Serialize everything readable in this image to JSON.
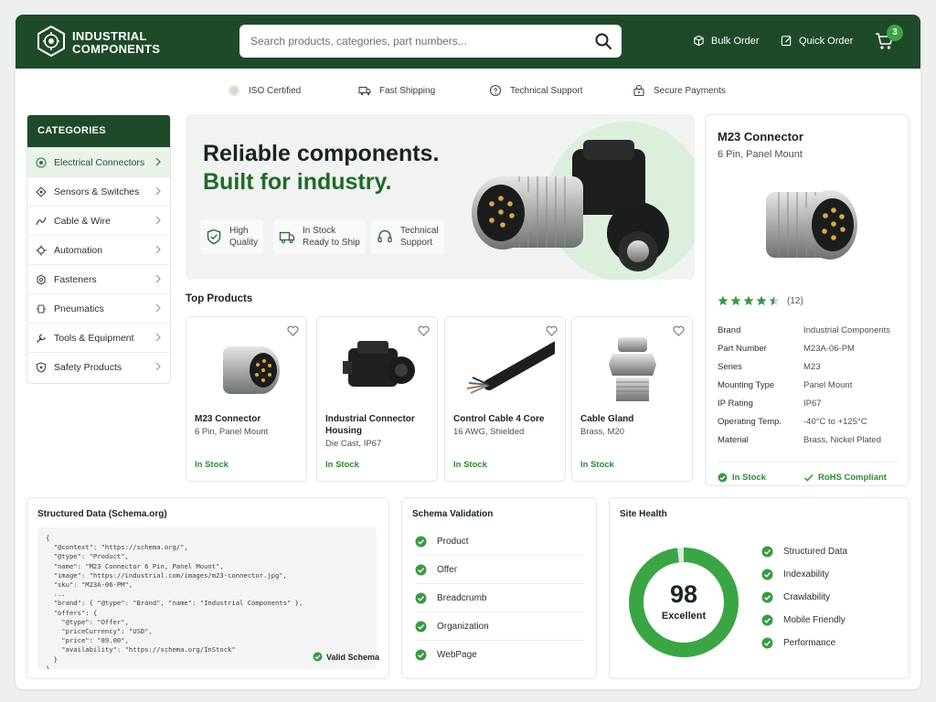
{
  "header": {
    "brand_line1": "INDUSTRIAL",
    "brand_line2": "COMPONENTS",
    "search_placeholder": "Search products, categories, part numbers...",
    "bulk_order": "Bulk Order",
    "quick_order": "Quick Order",
    "cart_count": "3"
  },
  "trust_bar": [
    {
      "label": "ISO Certified",
      "icon": "iso-badge-icon"
    },
    {
      "label": "Fast Shipping",
      "icon": "truck-icon"
    },
    {
      "label": "Technical Support",
      "icon": "support-icon"
    },
    {
      "label": "Secure Payments",
      "icon": "lock-icon"
    }
  ],
  "categories": {
    "title": "CATEGORIES",
    "items": [
      {
        "label": "Electrical Connectors",
        "icon": "connector-icon"
      },
      {
        "label": "Sensors & Switches",
        "icon": "sensor-icon"
      },
      {
        "label": "Cable & Wire",
        "icon": "cable-icon"
      },
      {
        "label": "Automation",
        "icon": "gear-icon"
      },
      {
        "label": "Fasteners",
        "icon": "fastener-icon"
      },
      {
        "label": "Pneumatics",
        "icon": "pneumatics-icon"
      },
      {
        "label": "Tools & Equipment",
        "icon": "wrench-icon"
      },
      {
        "label": "Safety Products",
        "icon": "shield-icon"
      }
    ]
  },
  "hero": {
    "headline_1": "Reliable components.",
    "headline_2": "Built for industry.",
    "features": [
      {
        "line1": "High",
        "line2": "Quality",
        "icon": "shield-check-icon"
      },
      {
        "line1": "In Stock",
        "line2": "Ready to Ship",
        "icon": "truck-icon"
      },
      {
        "line1": "Technical",
        "line2": "Support",
        "icon": "headset-icon"
      }
    ]
  },
  "top_products": {
    "title": "Top Products",
    "items": [
      {
        "name": "M23 Connector",
        "desc": "6 Pin, Panel Mount",
        "stock": "In Stock"
      },
      {
        "name": "Industrial Connector Housing",
        "desc": "Die Cast, IP67",
        "stock": "In Stock"
      },
      {
        "name": "Control Cable 4 Core",
        "desc": "16 AWG, Shielded",
        "stock": "In Stock"
      },
      {
        "name": "Cable Gland",
        "desc": "Brass, M20",
        "stock": "In Stock"
      }
    ]
  },
  "detail": {
    "title": "M23 Connector",
    "subtitle": "6 Pin, Panel Mount",
    "rating": 4.5,
    "reviews": "(12)",
    "specs": [
      {
        "k": "Brand",
        "v": "Industrial Components"
      },
      {
        "k": "Part Number",
        "v": "M23A-06-PM"
      },
      {
        "k": "Series",
        "v": "M23"
      },
      {
        "k": "Mounting Type",
        "v": "Panel Mount"
      },
      {
        "k": "IP Rating",
        "v": "IP67"
      },
      {
        "k": "Operating Temp.",
        "v": "-40°C to +125°C"
      },
      {
        "k": "Material",
        "v": "Brass, Nickel Plated"
      }
    ],
    "in_stock": "In Stock",
    "rohs": "RoHS Compliant"
  },
  "schema_panel": {
    "title": "Structured Data (Schema.org)",
    "code": "{\n  \"@context\": \"https://schema.org/\",\n  \"@type\": \"Product\",\n  \"name\": \"M23 Connector 6 Pin, Panel Mount\",\n  \"image\": \"https://industrial.com/images/m23-connector.jpg\",\n  \"sku\": \"M23A-06-PM\",\n  ...\n  \"brand\": { \"@type\": \"Brand\", \"name\": \"Industrial Components\" },\n  \"offers\": {\n    \"@type\": \"Offer\",\n    \"priceCurrency\": \"USD\",\n    \"price\": \"89.00\",\n    \"availability\": \"https://schema.org/InStock\"\n  }\n}",
    "valid": "Valid Schema"
  },
  "validation": {
    "title": "Schema Validation",
    "items": [
      "Product",
      "Offer",
      "Breadcrumb",
      "Organization",
      "WebPage"
    ]
  },
  "health": {
    "title": "Site Health",
    "score": "98",
    "score_value": 98,
    "score_label": "Excellent",
    "items": [
      "Structured Data",
      "Indexability",
      "Crawlability",
      "Mobile Friendly",
      "Performance"
    ]
  },
  "colors": {
    "brand_dark_green": "#1f4a2a",
    "accent_green": "#3aa543",
    "stock_green": "#2f8a37"
  }
}
